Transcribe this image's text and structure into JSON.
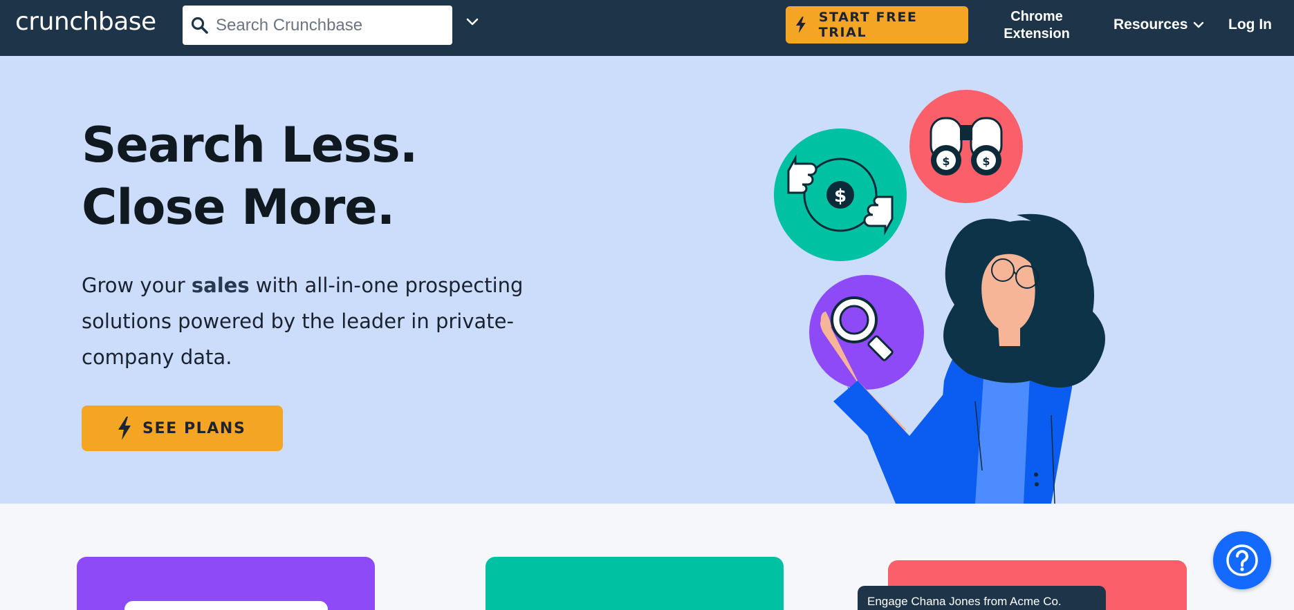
{
  "nav": {
    "logo": "crunchbase",
    "search_placeholder": "Search Crunchbase",
    "trial_label": "START FREE TRIAL",
    "chrome_line1": "Chrome",
    "chrome_line2": "Extension",
    "resources_label": "Resources",
    "login_label": "Log In"
  },
  "hero": {
    "headline_line1": "Search Less.",
    "headline_line2": "Close More.",
    "sub_before": "Grow your ",
    "sub_bold": "sales",
    "sub_after": " with all-in-one prospecting solutions powered by the leader in private-company data.",
    "cta_label": "SEE PLANS"
  },
  "cards": {
    "engage_text": "Engage Chana Jones from Acme Co."
  },
  "colors": {
    "nav_bg": "#1d3449",
    "hero_bg": "#ccdcfb",
    "accent_orange": "#f5a524",
    "teal": "#00c1a2",
    "purple": "#8f4af8",
    "coral": "#fb5f69",
    "help_blue": "#146aff"
  },
  "icons": [
    "search-icon",
    "chevron-down-icon",
    "lightning-icon",
    "help-icon",
    "binoculars-icon",
    "thumbs-icon",
    "magnifier-icon"
  ]
}
